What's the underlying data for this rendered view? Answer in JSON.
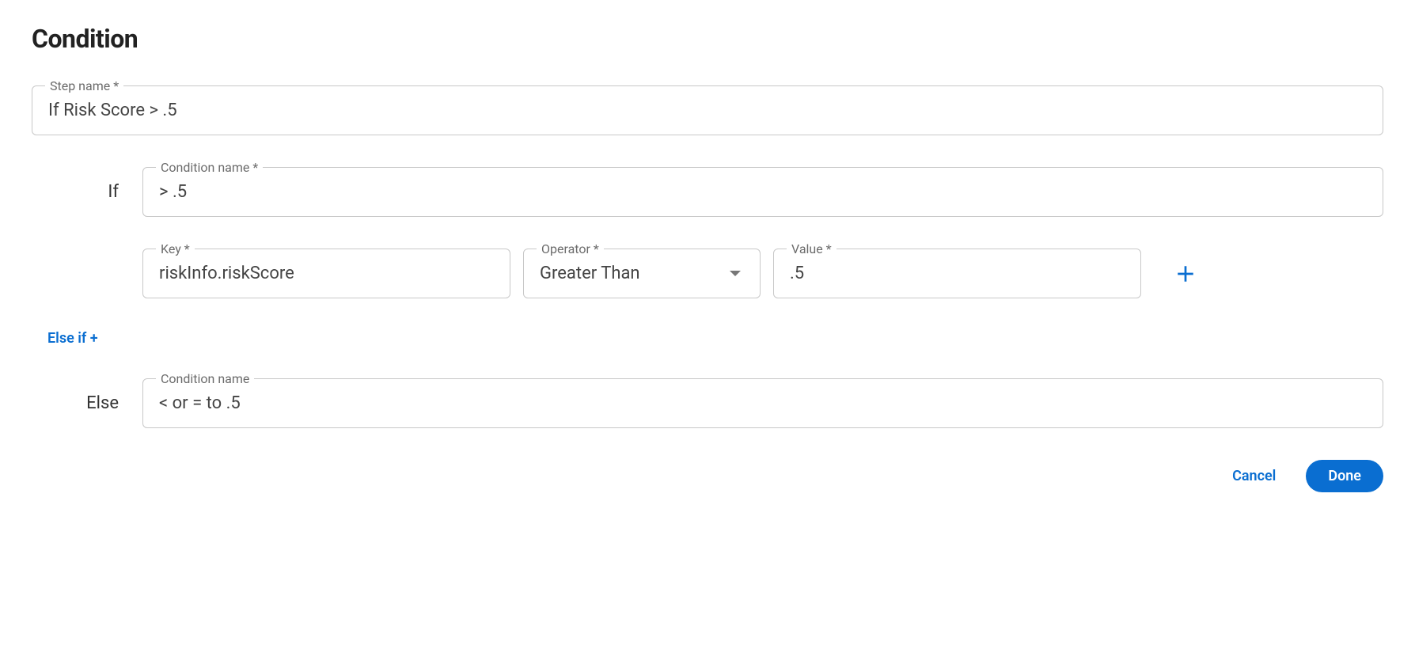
{
  "title": "Condition",
  "stepName": {
    "label": "Step name *",
    "value": "If Risk Score > .5"
  },
  "ifBranch": {
    "label": "If",
    "conditionName": {
      "label": "Condition name *",
      "value": "> .5"
    },
    "rule": {
      "key": {
        "label": "Key *",
        "value": "riskInfo.riskScore"
      },
      "operator": {
        "label": "Operator *",
        "value": "Greater Than"
      },
      "value": {
        "label": "Value *",
        "value": ".5"
      }
    }
  },
  "elseIfLink": "Else if +",
  "elseBranch": {
    "label": "Else",
    "conditionName": {
      "label": "Condition name",
      "value": "< or = to .5"
    }
  },
  "buttons": {
    "cancel": "Cancel",
    "done": "Done"
  }
}
